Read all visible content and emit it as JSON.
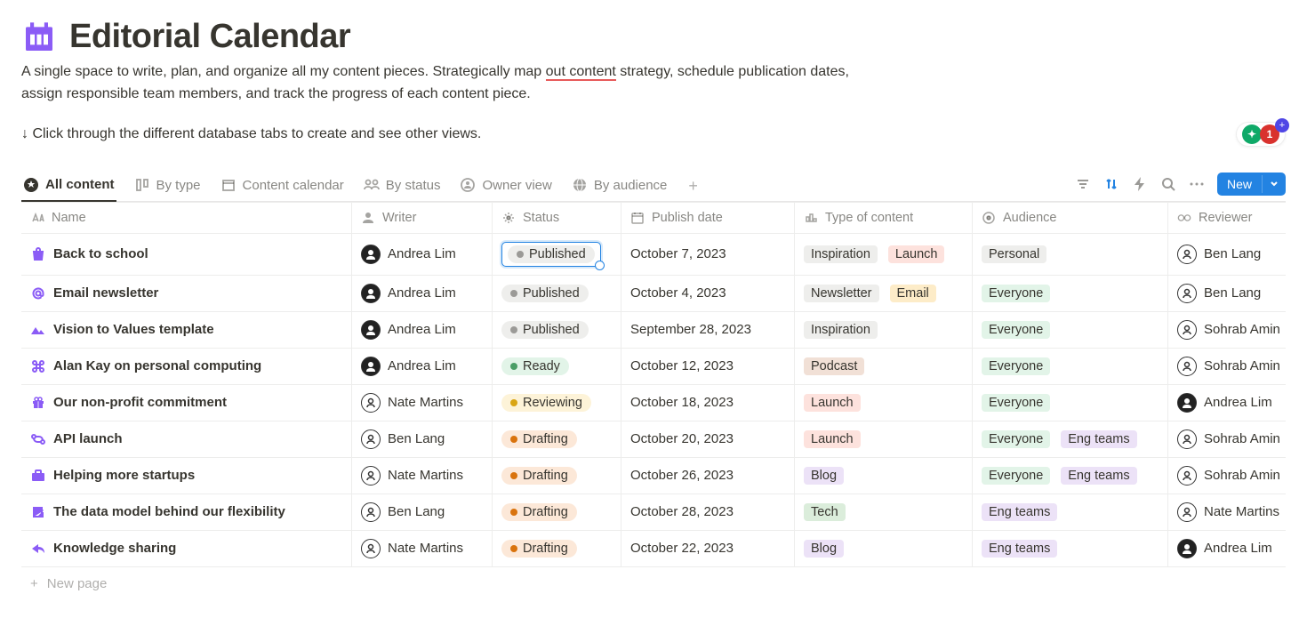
{
  "page": {
    "title": "Editorial Calendar",
    "description_before": "A single space to write, plan, and organize all my content pieces. Strategically map ",
    "description_underline": "out  content",
    "description_after": " strategy, schedule publication dates, assign responsible team members, and track the progress of each content piece.",
    "hint": "↓ Click through the different database tabs to create and see other views."
  },
  "widget": {
    "count": "1"
  },
  "tabs": [
    {
      "label": "All content",
      "icon": "star"
    },
    {
      "label": "By type",
      "icon": "board"
    },
    {
      "label": "Content calendar",
      "icon": "calendar"
    },
    {
      "label": "By status",
      "icon": "group"
    },
    {
      "label": "Owner view",
      "icon": "person"
    },
    {
      "label": "By audience",
      "icon": "globe"
    }
  ],
  "newButton": "New",
  "columns": {
    "name": "Name",
    "writer": "Writer",
    "status": "Status",
    "date": "Publish date",
    "type": "Type of content",
    "audience": "Audience",
    "reviewer": "Reviewer"
  },
  "rows": [
    {
      "icon": "bag",
      "name": "Back to school",
      "writer": "Andrea Lim",
      "wa": "f",
      "status": "Published",
      "sc": "pub",
      "date": "October 7, 2023",
      "type": [
        {
          "t": "Inspiration",
          "c": "gray"
        },
        {
          "t": "Launch",
          "c": "red"
        }
      ],
      "aud": [
        {
          "t": "Personal",
          "c": "gray"
        }
      ],
      "rev": "Ben Lang",
      "ra": "m",
      "sel": true
    },
    {
      "icon": "at",
      "name": "Email newsletter",
      "writer": "Andrea Lim",
      "wa": "f",
      "status": "Published",
      "sc": "pub",
      "date": "October 4, 2023",
      "type": [
        {
          "t": "Newsletter",
          "c": "gray"
        },
        {
          "t": "Email",
          "c": "yellow"
        }
      ],
      "aud": [
        {
          "t": "Everyone",
          "c": "greenlt"
        }
      ],
      "rev": "Ben Lang",
      "ra": "m"
    },
    {
      "icon": "mtn",
      "name": "Vision to Values template",
      "writer": "Andrea Lim",
      "wa": "f",
      "status": "Published",
      "sc": "pub",
      "date": "September 28, 2023",
      "type": [
        {
          "t": "Inspiration",
          "c": "gray"
        }
      ],
      "aud": [
        {
          "t": "Everyone",
          "c": "greenlt"
        }
      ],
      "rev": "Sohrab Amin",
      "ra": "m"
    },
    {
      "icon": "cmd",
      "name": "Alan Kay on personal computing",
      "writer": "Andrea Lim",
      "wa": "f",
      "status": "Ready",
      "sc": "ready",
      "date": "October 12, 2023",
      "type": [
        {
          "t": "Podcast",
          "c": "brown"
        }
      ],
      "aud": [
        {
          "t": "Everyone",
          "c": "greenlt"
        }
      ],
      "rev": "Sohrab Amin",
      "ra": "m"
    },
    {
      "icon": "gift",
      "name": "Our non-profit commitment",
      "writer": "Nate Martins",
      "wa": "m",
      "status": "Reviewing",
      "sc": "reviewing",
      "date": "October 18, 2023",
      "type": [
        {
          "t": "Launch",
          "c": "red"
        }
      ],
      "aud": [
        {
          "t": "Everyone",
          "c": "greenlt"
        }
      ],
      "rev": "Andrea Lim",
      "ra": "f"
    },
    {
      "icon": "api",
      "name": "API launch",
      "writer": "Ben Lang",
      "wa": "m",
      "status": "Drafting",
      "sc": "drafting",
      "date": "October 20, 2023",
      "type": [
        {
          "t": "Launch",
          "c": "red"
        }
      ],
      "aud": [
        {
          "t": "Everyone",
          "c": "greenlt"
        },
        {
          "t": "Eng teams",
          "c": "purple"
        }
      ],
      "rev": "Sohrab Amin",
      "ra": "m"
    },
    {
      "icon": "briefcase",
      "name": "Helping more startups",
      "writer": "Nate Martins",
      "wa": "m",
      "status": "Drafting",
      "sc": "drafting",
      "date": "October 26, 2023",
      "type": [
        {
          "t": "Blog",
          "c": "purple"
        }
      ],
      "aud": [
        {
          "t": "Everyone",
          "c": "greenlt"
        },
        {
          "t": "Eng teams",
          "c": "purple"
        }
      ],
      "rev": "Sohrab Amin",
      "ra": "m"
    },
    {
      "icon": "edit",
      "name": "The data model behind our flexibility",
      "writer": "Ben Lang",
      "wa": "m",
      "status": "Drafting",
      "sc": "drafting",
      "date": "October 28, 2023",
      "type": [
        {
          "t": "Tech",
          "c": "green"
        }
      ],
      "aud": [
        {
          "t": "Eng teams",
          "c": "purple"
        }
      ],
      "rev": "Nate Martins",
      "ra": "m"
    },
    {
      "icon": "share",
      "name": "Knowledge sharing",
      "writer": "Nate Martins",
      "wa": "m",
      "status": "Drafting",
      "sc": "drafting",
      "date": "October 22, 2023",
      "type": [
        {
          "t": "Blog",
          "c": "purple"
        }
      ],
      "aud": [
        {
          "t": "Eng teams",
          "c": "purple"
        }
      ],
      "rev": "Andrea Lim",
      "ra": "f"
    }
  ],
  "newPage": "New page"
}
